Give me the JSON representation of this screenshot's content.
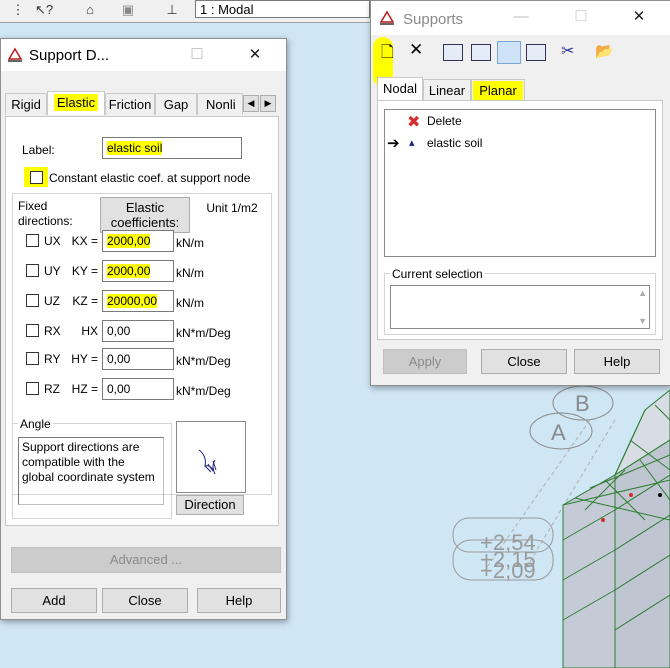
{
  "toolbar": {
    "combo_value": "1 : Modal",
    "icons": [
      "help-cursor-icon",
      "house-icon",
      "layers-icon",
      "structure-icon"
    ]
  },
  "support_dialog": {
    "title": "Support D...",
    "tabs": [
      "Rigid",
      "Elastic",
      "Friction",
      "Gap",
      "Nonli"
    ],
    "active_tab": "Elastic",
    "label_caption": "Label:",
    "label_value": "elastic soil",
    "constant_checkbox_label": "Constant elastic coef. at support node",
    "fixed_directions_label": "Fixed directions:",
    "elastic_coef_button": "Elastic coefficients:",
    "unit_header": "Unit 1/m2",
    "rows": [
      {
        "dir": "UX",
        "coef": "KX =",
        "value": "2000,00",
        "unit": "kN/m",
        "highlight": true
      },
      {
        "dir": "UY",
        "coef": "KY =",
        "value": "2000,00",
        "unit": "kN/m",
        "highlight": true
      },
      {
        "dir": "UZ",
        "coef": "KZ =",
        "value": "20000,00",
        "unit": "kN/m",
        "highlight": true
      },
      {
        "dir": "RX",
        "coef": "HX",
        "value": "0,00",
        "unit": "kN*m/Deg",
        "highlight": false
      },
      {
        "dir": "RY",
        "coef": "HY =",
        "value": "0,00",
        "unit": "kN*m/Deg",
        "highlight": false
      },
      {
        "dir": "RZ",
        "coef": "HZ =",
        "value": "0,00",
        "unit": "kN*m/Deg",
        "highlight": false
      }
    ],
    "angle_group": "Angle",
    "angle_text": "Support directions are compatible with the global coordinate system",
    "direction_button": "Direction",
    "advanced_button": "Advanced ...",
    "add_button": "Add",
    "close_button": "Close",
    "help_button": "Help"
  },
  "supports_window": {
    "title": "Supports",
    "tabs": [
      "Nodal",
      "Linear",
      "Planar"
    ],
    "active_tab": "Nodal",
    "highlight_tab": "Planar",
    "list_items": [
      {
        "label": "Delete",
        "icon": "red-x-icon",
        "marker": ""
      },
      {
        "label": "elastic soil",
        "icon": "support-icon",
        "marker": "arrow"
      }
    ],
    "current_selection_label": "Current selection",
    "apply_button": "Apply",
    "close_button": "Close",
    "help_button": "Help"
  },
  "viewport": {
    "axis_labels": [
      "B",
      "A"
    ],
    "level_labels": [
      "+2,54",
      "+2,15",
      "+2,09"
    ]
  },
  "colors": {
    "highlight": "#ffff00",
    "background": "#cfe6f5",
    "mesh_line": "#2e7d32",
    "mesh_face": "#c5cbd6"
  }
}
